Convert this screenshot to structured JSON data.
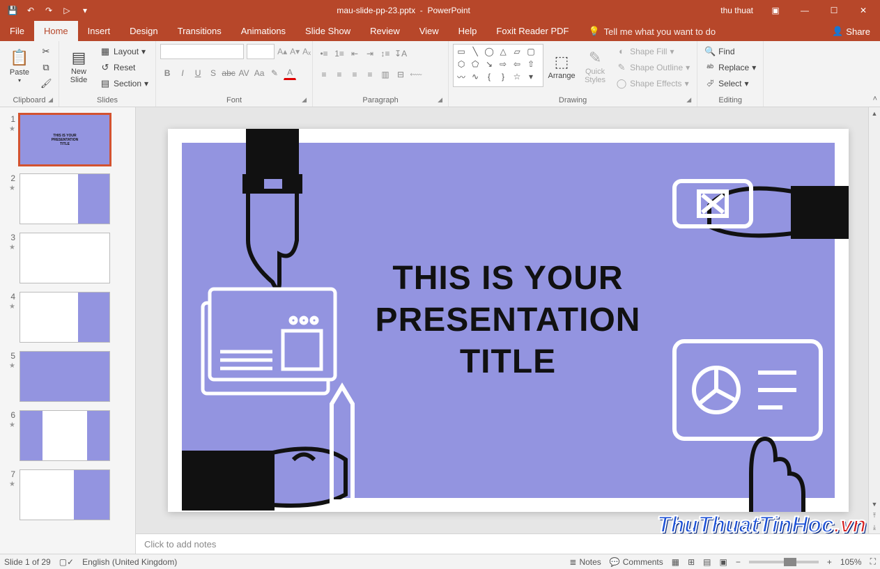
{
  "titlebar": {
    "filename": "mau-slide-pp-23.pptx",
    "appname": "PowerPoint",
    "user": "thu thuat"
  },
  "tabs": {
    "file": "File",
    "home": "Home",
    "insert": "Insert",
    "design": "Design",
    "transitions": "Transitions",
    "animations": "Animations",
    "slideshow": "Slide Show",
    "review": "Review",
    "view": "View",
    "help": "Help",
    "foxit": "Foxit Reader PDF",
    "tell": "Tell me what you want to do",
    "share": "Share"
  },
  "ribbon": {
    "clipboard": {
      "label": "Clipboard",
      "paste": "Paste"
    },
    "slides": {
      "label": "Slides",
      "newslide": "New\nSlide",
      "layout": "Layout",
      "reset": "Reset",
      "section": "Section"
    },
    "font": {
      "label": "Font"
    },
    "paragraph": {
      "label": "Paragraph"
    },
    "drawing": {
      "label": "Drawing",
      "arrange": "Arrange",
      "quick": "Quick\nStyles",
      "fill": "Shape Fill",
      "outline": "Shape Outline",
      "effects": "Shape Effects"
    },
    "editing": {
      "label": "Editing",
      "find": "Find",
      "replace": "Replace",
      "select": "Select"
    }
  },
  "thumbs": [
    "1",
    "2",
    "3",
    "4",
    "5",
    "6",
    "7"
  ],
  "slide": {
    "title": "THIS IS YOUR\nPRESENTATION\nTITLE"
  },
  "notes_placeholder": "Click to add notes",
  "status": {
    "slide": "Slide 1 of 29",
    "lang": "English (United Kingdom)",
    "notes": "Notes",
    "comments": "Comments",
    "zoom": "105%"
  },
  "watermark": {
    "main": "ThuThuatTinHoc",
    "ext": ".vn"
  }
}
